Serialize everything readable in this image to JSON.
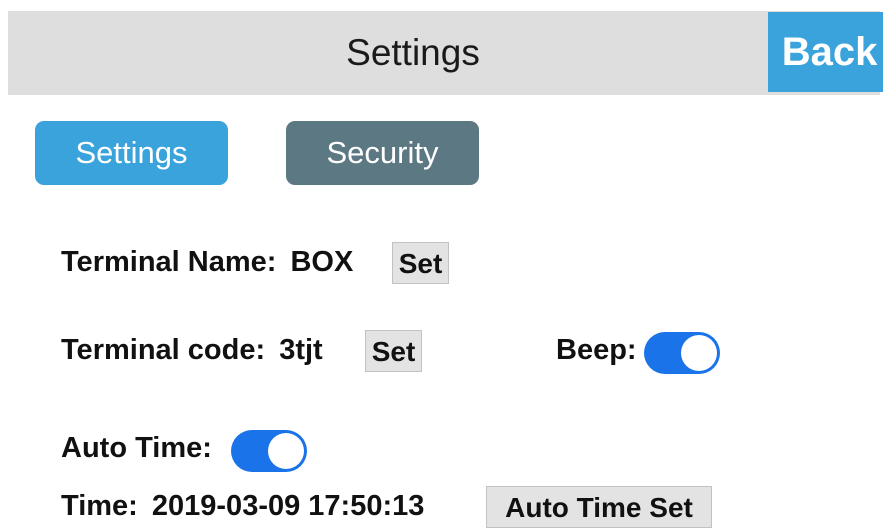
{
  "header": {
    "title": "Settings",
    "back_label": "Back"
  },
  "tabs": [
    {
      "label": "Settings",
      "active": true,
      "color": "#3aa3dc"
    },
    {
      "label": "Security",
      "active": false,
      "color": "#5c7883"
    }
  ],
  "terminal_name": {
    "label": "Terminal Name:",
    "value": "BOX",
    "set_label": "Set"
  },
  "terminal_code": {
    "label": "Terminal code:",
    "value": "3tjt",
    "set_label": "Set"
  },
  "beep": {
    "label": "Beep:",
    "enabled": true
  },
  "auto_time": {
    "label": "Auto Time:",
    "enabled": true
  },
  "time": {
    "label": "Time:",
    "value": "2019-03-09 17:50:13",
    "set_label": "Auto Time Set"
  },
  "colors": {
    "accent": "#3aa3dc",
    "toggle_on": "#1a73e8",
    "header_bg": "#dedede"
  }
}
